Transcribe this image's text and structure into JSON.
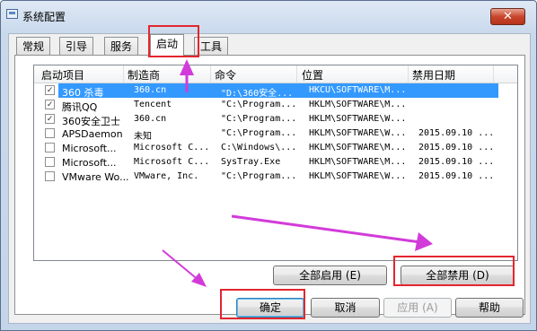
{
  "window": {
    "title": "系统配置",
    "close_label": "✕"
  },
  "tabs": [
    {
      "label": "常规"
    },
    {
      "label": "引导"
    },
    {
      "label": "服务"
    },
    {
      "label": "启动"
    },
    {
      "label": "工具"
    }
  ],
  "columns": [
    "启动项目",
    "制造商",
    "命令",
    "位置",
    "禁用日期"
  ],
  "rows": [
    {
      "checked": true,
      "item": "360 杀毒",
      "maker": "360.cn",
      "command": "\"D:\\360安全...",
      "location": "HKCU\\SOFTWARE\\M...",
      "date": ""
    },
    {
      "checked": true,
      "item": "腾讯QQ",
      "maker": "Tencent",
      "command": "\"C:\\Program...",
      "location": "HKLM\\SOFTWARE\\M...",
      "date": ""
    },
    {
      "checked": true,
      "item": "360安全卫士",
      "maker": "360.cn",
      "command": "\"C:\\Program...",
      "location": "HKLM\\SOFTWARE\\W...",
      "date": ""
    },
    {
      "checked": false,
      "item": "APSDaemon",
      "maker": "未知",
      "command": "\"C:\\Program...",
      "location": "HKLM\\SOFTWARE\\W...",
      "date": "2015.09.10 ..."
    },
    {
      "checked": false,
      "item": "Microsoft...",
      "maker": "Microsoft C...",
      "command": "C:\\Windows\\...",
      "location": "HKLM\\SOFTWARE\\M...",
      "date": "2015.09.10 ..."
    },
    {
      "checked": false,
      "item": "Microsoft...",
      "maker": "Microsoft C...",
      "command": "SysTray.Exe",
      "location": "HKLM\\SOFTWARE\\M...",
      "date": "2015.09.10 ..."
    },
    {
      "checked": false,
      "item": "VMware Wo...",
      "maker": "VMware, Inc.",
      "command": "\"C:\\Program...",
      "location": "HKLM\\SOFTWARE\\W...",
      "date": "2015.09.10 ..."
    }
  ],
  "buttons": {
    "enable_all": "全部启用 (E)",
    "disable_all": "全部禁用 (D)",
    "ok": "确定",
    "cancel": "取消",
    "apply": "应用 (A)",
    "help": "帮助"
  },
  "annotation_color": "#e3262e",
  "arrow_color": "#d23bd9",
  "selection_color": "#3399ff"
}
